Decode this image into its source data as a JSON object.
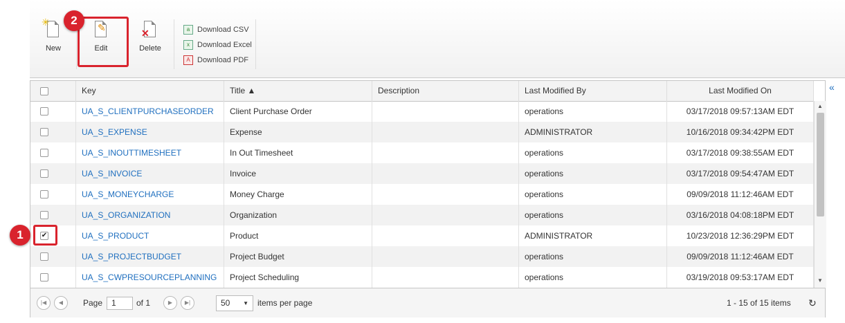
{
  "toolbar": {
    "new_label": "New",
    "edit_label": "Edit",
    "delete_label": "Delete",
    "download_csv": "Download CSV",
    "download_excel": "Download Excel",
    "download_pdf": "Download PDF"
  },
  "callouts": {
    "one": "1",
    "two": "2"
  },
  "grid": {
    "columns": {
      "key": "Key",
      "title": "Title ▲",
      "description": "Description",
      "modified_by": "Last Modified By",
      "modified_on": "Last Modified On"
    },
    "rows": [
      {
        "key": "UA_S_CLIENTPURCHASEORDER",
        "title": "Client Purchase Order",
        "description": "",
        "by": "operations",
        "on": "03/17/2018 09:57:13AM EDT",
        "checked": false
      },
      {
        "key": "UA_S_EXPENSE",
        "title": "Expense",
        "description": "",
        "by": "ADMINISTRATOR",
        "on": "10/16/2018 09:34:42PM EDT",
        "checked": false
      },
      {
        "key": "UA_S_INOUTTIMESHEET",
        "title": "In Out Timesheet",
        "description": "",
        "by": "operations",
        "on": "03/17/2018 09:38:55AM EDT",
        "checked": false
      },
      {
        "key": "UA_S_INVOICE",
        "title": "Invoice",
        "description": "",
        "by": "operations",
        "on": "03/17/2018 09:54:47AM EDT",
        "checked": false
      },
      {
        "key": "UA_S_MONEYCHARGE",
        "title": "Money Charge",
        "description": "",
        "by": "operations",
        "on": "09/09/2018 11:12:46AM EDT",
        "checked": false
      },
      {
        "key": "UA_S_ORGANIZATION",
        "title": "Organization",
        "description": "",
        "by": "operations",
        "on": "03/16/2018 04:08:18PM EDT",
        "checked": false
      },
      {
        "key": "UA_S_PRODUCT",
        "title": "Product",
        "description": "",
        "by": "ADMINISTRATOR",
        "on": "10/23/2018 12:36:29PM EDT",
        "checked": true
      },
      {
        "key": "UA_S_PROJECTBUDGET",
        "title": "Project Budget",
        "description": "",
        "by": "operations",
        "on": "09/09/2018 11:12:46AM EDT",
        "checked": false
      },
      {
        "key": "UA_S_CWPRESOURCEPLANNING",
        "title": "Project Scheduling",
        "description": "",
        "by": "operations",
        "on": "03/19/2018 09:53:17AM EDT",
        "checked": false
      }
    ]
  },
  "pager": {
    "page_label": "Page",
    "page_value": "1",
    "of_label": "of 1",
    "per_page_value": "50",
    "per_page_label": "items per page",
    "summary": "1 - 15 of 15 items"
  },
  "icons": {
    "first": "|◀",
    "prev": "◀",
    "next": "▶",
    "last": "▶|",
    "dropdown": "▼",
    "refresh": "↻",
    "collapse": "«",
    "sort_up": "▲",
    "sort_down": "▼",
    "check": "✔",
    "csv_glyph": "a",
    "excel_glyph": "x",
    "pdf_glyph": "A",
    "delete_glyph": "✕",
    "edit_glyph": "✎",
    "new_glyph": "✳"
  },
  "colors": {
    "callout": "#d9232d",
    "link": "#1f6fbf"
  }
}
